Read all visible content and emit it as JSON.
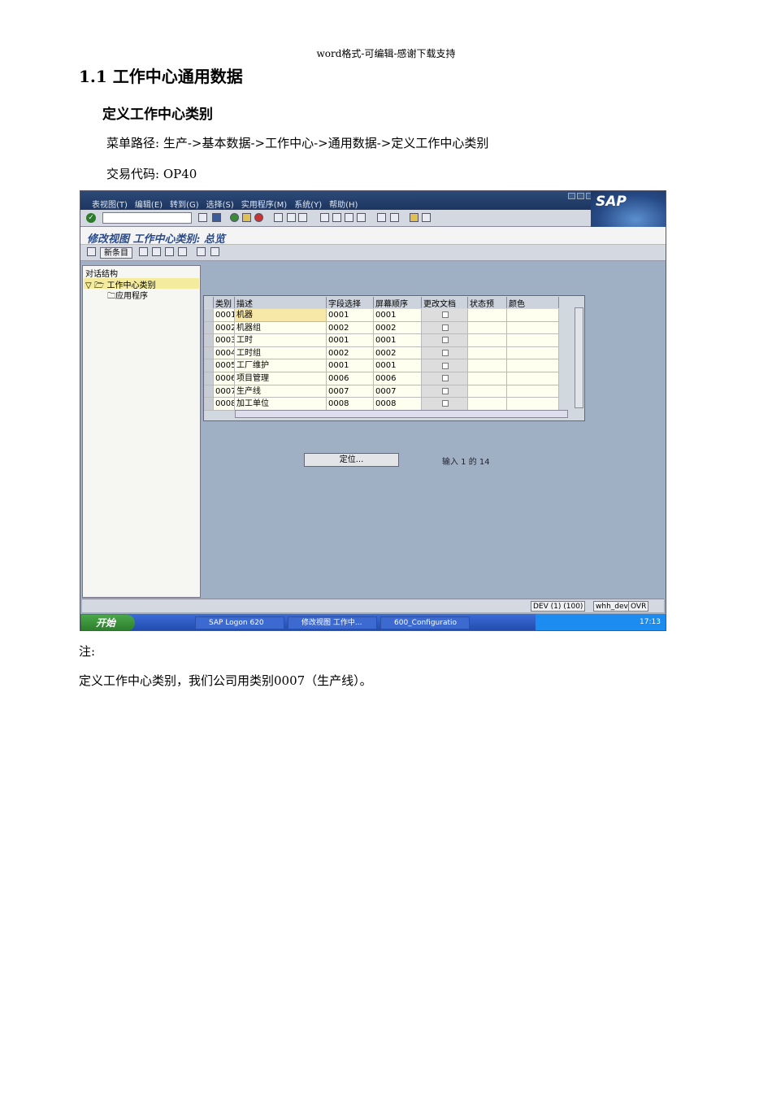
{
  "doc": {
    "header": "word格式-可编辑-感谢下载支持",
    "heading1": "1.1 工作中心通用数据",
    "heading2": "定义工作中心类别",
    "menu_path": "菜单路径: 生产->基本数据->工作中心->通用数据->定义工作中心类别",
    "tcode_line": "交易代码:  OP40",
    "note_label": "注:",
    "note_text": "定义工作中心类别，我们公司用类别0007（生产线）。"
  },
  "sap": {
    "menu": [
      "表视图(T)",
      "编辑(E)",
      "转到(G)",
      "选择(S)",
      "实用程序(M)",
      "系统(Y)",
      "帮助(H)"
    ],
    "logo": "SAP",
    "title": "修改视图 工作中心类别: 总览",
    "new_entries": "新条目",
    "tree_title": "对话结构",
    "tree_node_1": "工作中心类别",
    "tree_node_2": "应用程序",
    "columns": [
      "类别",
      "描述",
      "字段选择",
      "屏幕顺序",
      "更改文档",
      "状态预",
      "颜色"
    ],
    "rows": [
      {
        "cat": "0001",
        "desc": "机器",
        "field": "0001",
        "screen": "0001"
      },
      {
        "cat": "0002",
        "desc": "机器组",
        "field": "0002",
        "screen": "0002"
      },
      {
        "cat": "0003",
        "desc": "工时",
        "field": "0001",
        "screen": "0001"
      },
      {
        "cat": "0004",
        "desc": "工时组",
        "field": "0002",
        "screen": "0002"
      },
      {
        "cat": "0005",
        "desc": "工厂维护",
        "field": "0001",
        "screen": "0001"
      },
      {
        "cat": "0006",
        "desc": "项目管理",
        "field": "0006",
        "screen": "0006"
      },
      {
        "cat": "0007",
        "desc": "生产线",
        "field": "0007",
        "screen": "0007"
      },
      {
        "cat": "0008",
        "desc": "加工单位",
        "field": "0008",
        "screen": "0008"
      }
    ],
    "position_button": "定位...",
    "entry_info": "输入 1 的 14",
    "status": {
      "system": "DEV (1) (100)",
      "user": "whh_dev",
      "mode": "OVR"
    },
    "taskbar": {
      "start": "开始",
      "task1": "SAP Logon 620",
      "task2": "修改视图 工作中...",
      "task3": "600_Configuratio",
      "clock": "17:13"
    }
  }
}
